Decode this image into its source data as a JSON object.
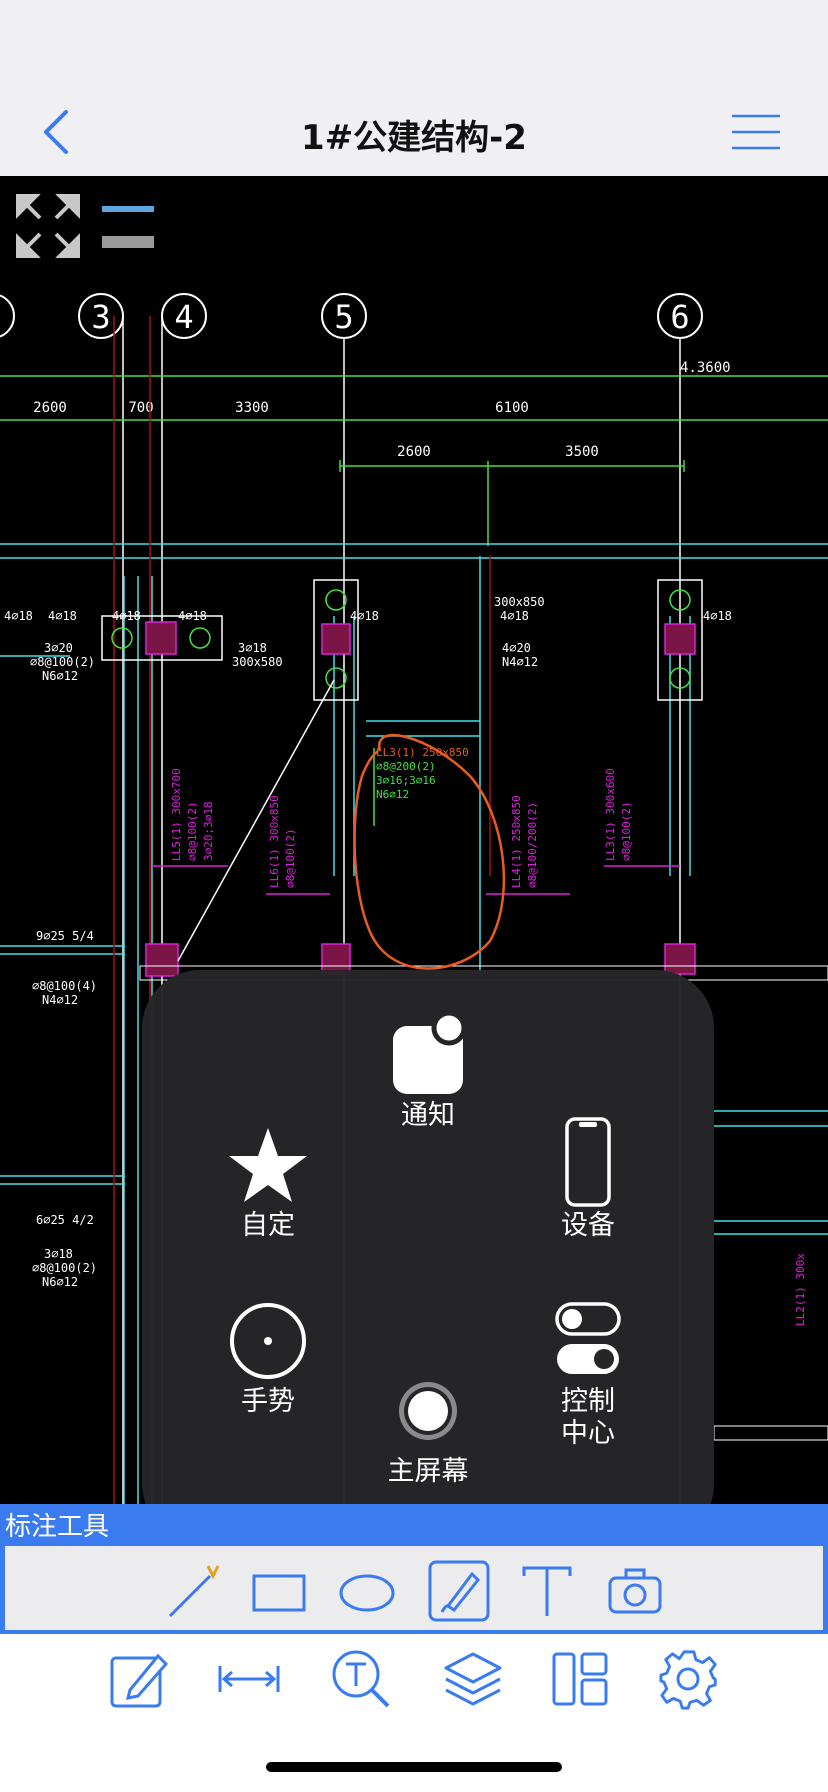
{
  "header": {
    "title": "1#公建结构-2"
  },
  "drawing": {
    "axis_labels": [
      "3",
      "4",
      "5",
      "6"
    ],
    "top_dims": [
      "2600",
      "700",
      "3300",
      "6100"
    ],
    "elev": "4.3600",
    "sub_dims": [
      "2600",
      "3500"
    ],
    "beam_notes": {
      "a": "4⌀18",
      "b": "4⌀18",
      "c": "4⌀18",
      "d": "4⌀18",
      "e": "4⌀18",
      "f": "4⌀18",
      "g": "3⌀20",
      "g2": "⌀8@100(2)",
      "g3": "N6⌀12",
      "h": "3⌀18",
      "h2": "300x580",
      "i": "300x850",
      "i2": "4⌀18",
      "j": "4⌀20",
      "j2": "N4⌀12",
      "k": "9⌀25 5/4",
      "l": "⌀8@100(4)",
      "l2": "N4⌀12",
      "m": "6⌀25 4/2",
      "n": "3⌀18",
      "n2": "⌀8@100(2)",
      "n3": "N6⌀12"
    },
    "markup_text": [
      "LL3(1) 250x850",
      "⌀8@200(2)",
      "3⌀16;3⌀16",
      "N6⌀12"
    ]
  },
  "assistive_touch": {
    "notification": "通知",
    "custom": "自定",
    "device": "设备",
    "gesture": "手势",
    "control_center": [
      "控制",
      "中心"
    ],
    "home": "主屏幕"
  },
  "annotation": {
    "title": "标注工具",
    "tools": [
      "line-tool",
      "rectangle-tool",
      "ellipse-tool",
      "brush-tool",
      "text-tool",
      "camera-tool"
    ]
  },
  "bottom_toolbar": [
    "edit-icon",
    "measure-icon",
    "text-search-icon",
    "layers-icon",
    "layout-icon",
    "settings-icon"
  ],
  "colors": {
    "accent": "#3a7cf0",
    "cad_background": "#000000",
    "markup": "#e85d1f",
    "beam_magenta": "#e020e0",
    "grid_green": "#43e043",
    "cyan": "#40e0e8"
  }
}
